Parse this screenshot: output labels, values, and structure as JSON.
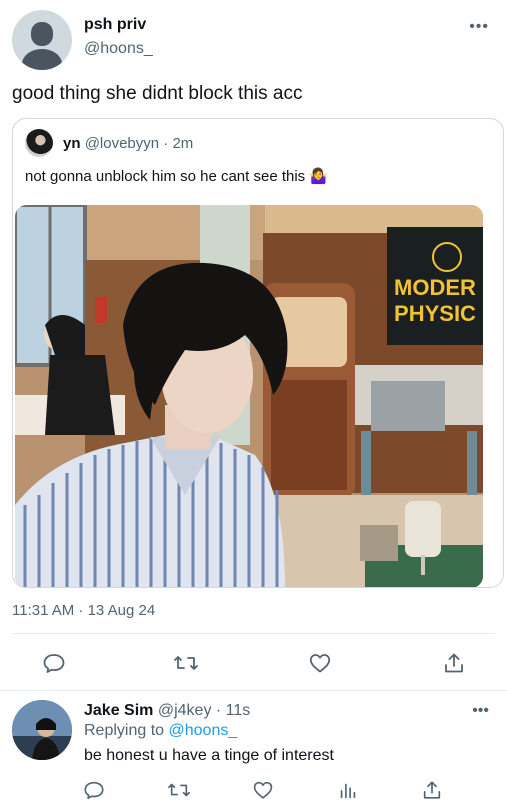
{
  "tweet": {
    "display_name": "psh priv",
    "handle": "@hoons_",
    "more": "•••",
    "text": "good thing she didnt block this acc",
    "timestamp": "11:31 AM · 13 Aug 24"
  },
  "quote": {
    "name": "yn",
    "handle_time": "@lovebyyn · 2m",
    "text": "not gonna unblock him so he cant see this 🤷‍♀️",
    "photo_sign": [
      "MODER",
      "PHYSIC"
    ]
  },
  "actions": [
    "reply-icon",
    "retweet-icon",
    "like-icon",
    "share-icon"
  ],
  "reply": {
    "name": "Jake Sim",
    "handle_time": "@j4key · 11s",
    "replying_label": "Replying to",
    "replying_to": "@hoons_",
    "text": "be honest u have a tinge of interest",
    "more": "•••",
    "actions": [
      "reply-icon",
      "retweet-icon",
      "like-icon",
      "views-icon",
      "share-icon"
    ]
  },
  "colors": {
    "text": "#0f1419",
    "secondary": "#536471",
    "link": "#1d9bf0",
    "border": "#cfd9de"
  }
}
